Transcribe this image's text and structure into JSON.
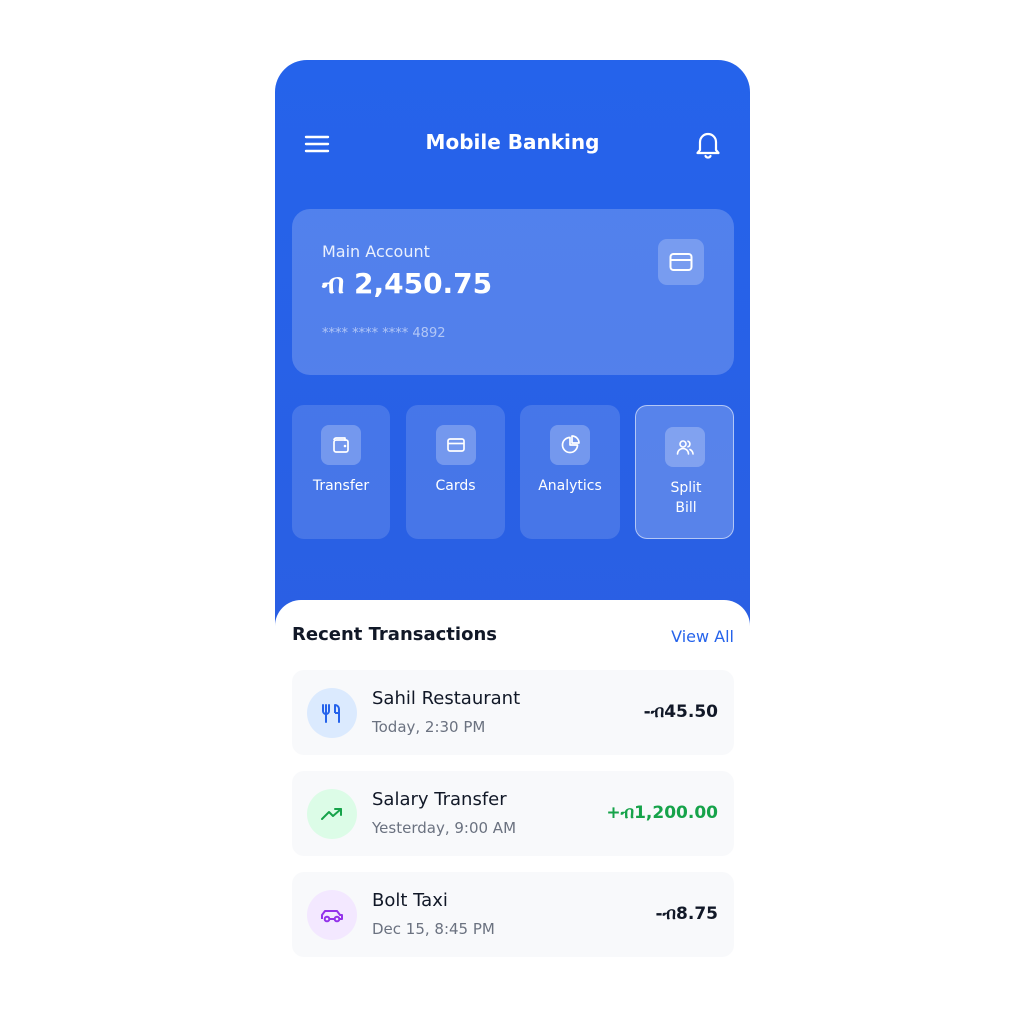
{
  "header": {
    "title": "Mobile Banking"
  },
  "balance": {
    "label": "Main Account",
    "amount": "ብ 2,450.75",
    "card_number": "**** **** **** 4892"
  },
  "actions": [
    {
      "label": "Transfer",
      "icon": "wallet-icon"
    },
    {
      "label": "Cards",
      "icon": "card-icon"
    },
    {
      "label": "Analytics",
      "icon": "pie-chart-icon"
    },
    {
      "label": "Split Bill",
      "icon": "users-icon",
      "active": true
    }
  ],
  "transactions": {
    "title": "Recent Transactions",
    "view_all": "View All",
    "items": [
      {
        "name": "Sahil Restaurant",
        "time": "Today, 2:30 PM",
        "amount": "-ብ45.50",
        "icon": "utensils-icon",
        "icon_bg": "#dbeafe",
        "icon_color": "#2563eb"
      },
      {
        "name": "Salary Transfer",
        "time": "Yesterday, 9:00 AM",
        "amount": "+ብ1,200.00",
        "icon": "trending-up-icon",
        "icon_bg": "#dcfce7",
        "icon_color": "#16a34a"
      },
      {
        "name": "Bolt Taxi",
        "time": "Dec 15, 8:45 PM",
        "amount": "-ብ8.75",
        "icon": "car-icon",
        "icon_bg": "#f3e8ff",
        "icon_color": "#9333ea"
      }
    ]
  },
  "colors": {
    "primary": "#2563eb",
    "positive": "#16a34a",
    "text": "#111827",
    "muted": "#6b7280"
  }
}
